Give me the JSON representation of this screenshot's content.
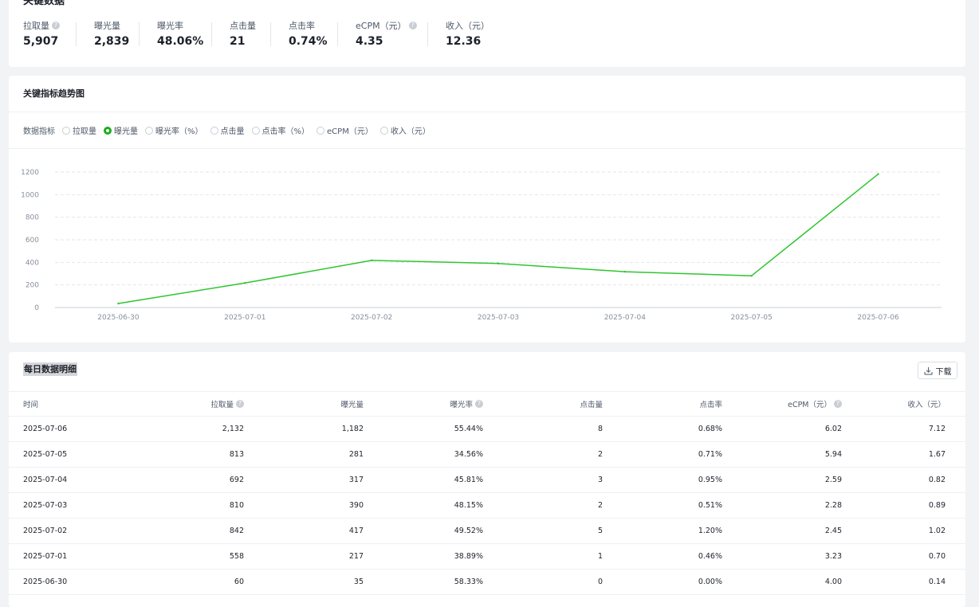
{
  "summary": {
    "section_title": "关键数据",
    "metrics": [
      {
        "label": "拉取量",
        "value": "5,907",
        "help": true
      },
      {
        "label": "曝光量",
        "value": "2,839",
        "help": false
      },
      {
        "label": "曝光率",
        "value": "48.06%",
        "help": false
      },
      {
        "label": "点击量",
        "value": "21",
        "help": false
      },
      {
        "label": "点击率",
        "value": "0.74%",
        "help": false
      },
      {
        "label": "eCPM（元）",
        "value": "4.35",
        "help": true
      },
      {
        "label": "收入（元）",
        "value": "12.36",
        "help": false
      }
    ]
  },
  "trend": {
    "title": "关键指标趋势图",
    "selector_label": "数据指标",
    "options": [
      {
        "label": "拉取量",
        "checked": false
      },
      {
        "label": "曝光量",
        "checked": true
      },
      {
        "label": "曝光率（%）",
        "checked": false
      },
      {
        "label": "点击量",
        "checked": false
      },
      {
        "label": "点击率（%）",
        "checked": false
      },
      {
        "label": "eCPM（元）",
        "checked": false
      },
      {
        "label": "收入（元）",
        "checked": false
      }
    ]
  },
  "chart_data": {
    "type": "line",
    "x": [
      "2025-06-30",
      "2025-07-01",
      "2025-07-02",
      "2025-07-03",
      "2025-07-04",
      "2025-07-05",
      "2025-07-06"
    ],
    "series": [
      {
        "values": [
          35,
          217,
          417,
          390,
          317,
          281,
          1182
        ],
        "color": "#2fc52f"
      }
    ],
    "yticks": [
      0,
      200,
      400,
      600,
      800,
      1000,
      1200
    ],
    "ylim": [
      0,
      1200
    ],
    "grid": true
  },
  "daily": {
    "title": "每日数据明细",
    "download_label": "下载",
    "columns": [
      "时间",
      "拉取量",
      "曝光量",
      "曝光率",
      "点击量",
      "点击率",
      "eCPM（元）",
      "收入（元）"
    ],
    "rows": [
      [
        "2025-07-06",
        "2,132",
        "1,182",
        "55.44%",
        "8",
        "0.68%",
        "6.02",
        "7.12"
      ],
      [
        "2025-07-05",
        "813",
        "281",
        "34.56%",
        "2",
        "0.71%",
        "5.94",
        "1.67"
      ],
      [
        "2025-07-04",
        "692",
        "317",
        "45.81%",
        "3",
        "0.95%",
        "2.59",
        "0.82"
      ],
      [
        "2025-07-03",
        "810",
        "390",
        "48.15%",
        "2",
        "0.51%",
        "2.28",
        "0.89"
      ],
      [
        "2025-07-02",
        "842",
        "417",
        "49.52%",
        "5",
        "1.20%",
        "2.45",
        "1.02"
      ],
      [
        "2025-07-01",
        "558",
        "217",
        "38.89%",
        "1",
        "0.46%",
        "3.23",
        "0.70"
      ],
      [
        "2025-06-30",
        "60",
        "35",
        "58.33%",
        "0",
        "0.00%",
        "4.00",
        "0.14"
      ]
    ]
  }
}
